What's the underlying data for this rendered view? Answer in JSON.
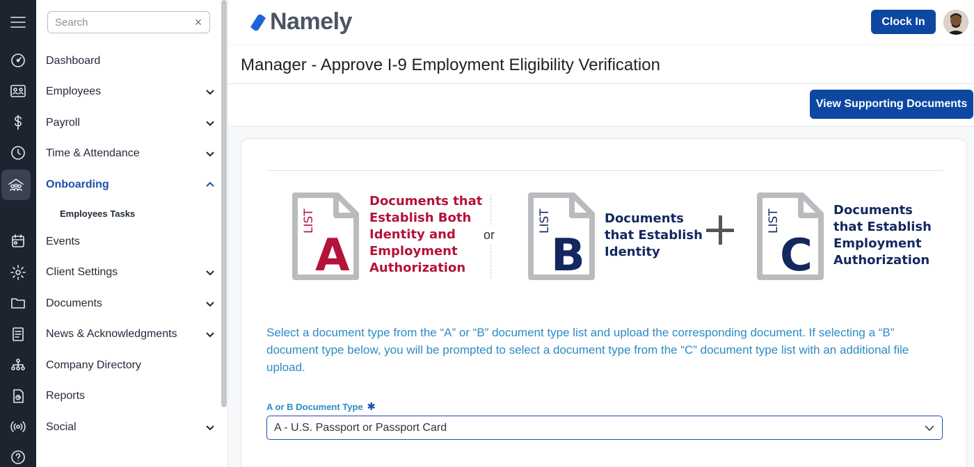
{
  "app": {
    "brand": "Namely",
    "brand_color": "#0d47a1",
    "accent_text_color": "#2b8bc6"
  },
  "rail": {
    "icons": [
      "menu-icon",
      "dashboard-icon",
      "people-icon",
      "dollar-icon",
      "clock-icon",
      "onboarding-icon",
      "calendar-icon",
      "gear-icon",
      "folder-icon",
      "news-icon",
      "org-chart-icon",
      "report-icon",
      "broadcast-icon",
      "help-icon"
    ]
  },
  "sidebar": {
    "search_placeholder": "Search",
    "search_clear": "×",
    "items": [
      {
        "label": "Dashboard"
      },
      {
        "label": "Employees"
      },
      {
        "label": "Payroll"
      },
      {
        "label": "Time & Attendance"
      },
      {
        "label": "Onboarding"
      },
      {
        "label": "Events"
      },
      {
        "label": "Client Settings"
      },
      {
        "label": "Documents"
      },
      {
        "label": "News & Acknowledgments"
      },
      {
        "label": "Company Directory"
      },
      {
        "label": "Reports"
      },
      {
        "label": "Social"
      }
    ],
    "subitems": [
      {
        "label": "Employees Tasks"
      }
    ]
  },
  "header": {
    "clock_in_label": "Clock In"
  },
  "page": {
    "title": "Manager - Approve I-9 Employment Eligibility Verification"
  },
  "actions": {
    "view_docs_label": "View Supporting Documents"
  },
  "lists": [
    {
      "list_word": "LIST",
      "letter": "A",
      "description_lines": [
        "Documents that",
        "Establish Both",
        "Identity and",
        "Employment",
        "Authorization"
      ],
      "color": "#b5123a"
    },
    {
      "list_word": "LIST",
      "letter": "B",
      "description_lines": [
        "Documents",
        "that Establish",
        "Identity"
      ],
      "color": "#14285f"
    },
    {
      "list_word": "LIST",
      "letter": "C",
      "description_lines": [
        "Documents",
        "that Establish",
        "Employment",
        "Authorization"
      ],
      "color": "#14285f"
    }
  ],
  "or_text": "or",
  "instructions": "Select a document type from the “A” or “B” document type list and upload the corresponding document. If selecting a “B” document type below, you will be prompted to select a document type from the “C” document type list with an additional file upload.",
  "form": {
    "doc_type_label": "A or B Document Type",
    "required_marker": "✱",
    "doc_type_value": "A - U.S. Passport or Passport Card"
  }
}
